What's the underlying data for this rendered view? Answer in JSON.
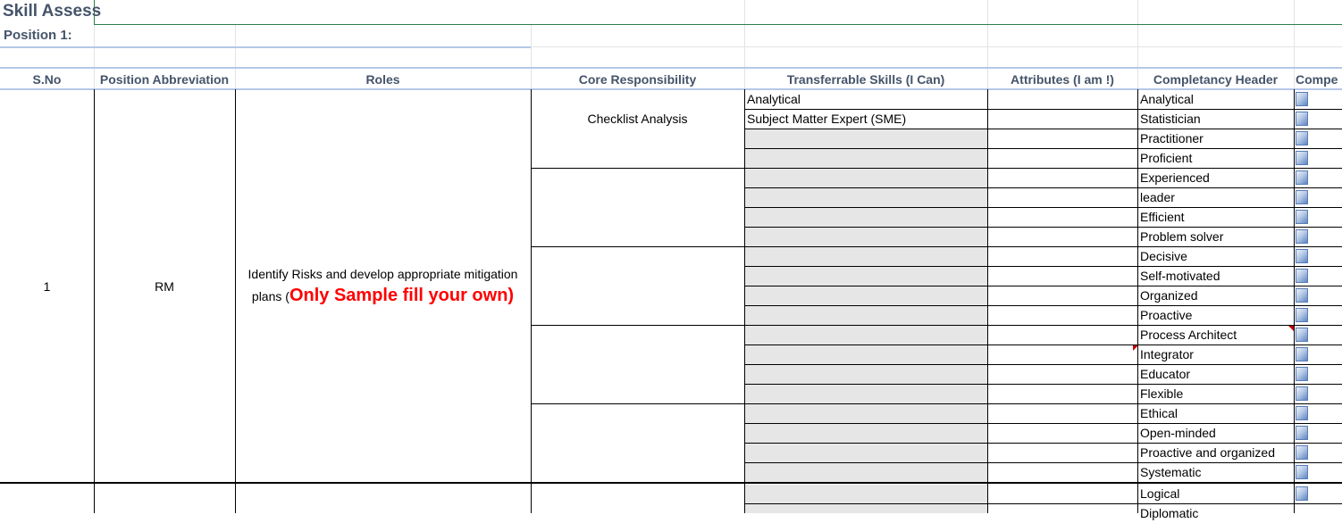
{
  "sheet": {
    "title": "Skill Assess",
    "position_label": "Position 1:"
  },
  "headers": {
    "sno": "S.No",
    "position_abbreviation": "Position Abbreviation",
    "roles": "Roles",
    "core_responsibility": "Core Responsibility",
    "transferrable_skills": "Transferrable Skills (I Can)",
    "attributes": "Attributes (I am !)",
    "competency_header": "Completancy Header",
    "competency_cut": "Compe"
  },
  "row1": {
    "sno": "1",
    "abbreviation": "RM",
    "roles_line1": "Identify Risks and develop appropriate mitigation",
    "roles_line2_prefix": "plans (",
    "roles_note": "Only Sample fill your own)",
    "core_responsibility": "Checklist Analysis",
    "transferrable_skills": [
      "Analytical",
      "Subject Matter Expert (SME)"
    ]
  },
  "competencies": [
    "Analytical",
    "Statistician",
    "Practitioner",
    "Proficient",
    "Experienced",
    "leader",
    "Efficient",
    "Problem solver",
    "Decisive",
    "Self-motivated",
    "Organized",
    "Proactive",
    "Process Architect",
    "Integrator",
    "Educator",
    "Flexible",
    "Ethical",
    "Open-minded",
    "Proactive and organized",
    "Systematic",
    "Logical",
    "Diplomatic"
  ],
  "colors": {
    "header_text": "#44546a",
    "note_red": "#ff0000",
    "gray_fill": "#e7e6e6",
    "title_border": "#2e7d4f"
  }
}
